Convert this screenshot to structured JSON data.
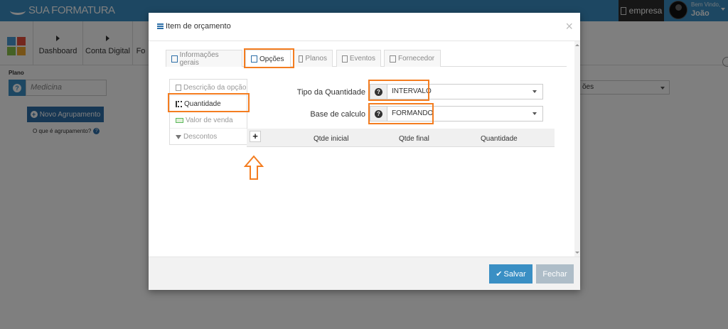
{
  "app": {
    "logo_text": "SUA FORMATURA",
    "empresa_label": "empresa",
    "welcome_text": "Bem Vindo,",
    "user_name": "João"
  },
  "nav": {
    "items": [
      {
        "label": "Dashboard"
      },
      {
        "label": "Conta Digital"
      },
      {
        "label": "Fo"
      }
    ]
  },
  "background": {
    "plan_label": "Plano",
    "plan_value": "Medicina",
    "novo_agrupamento_label": "Novo Agrupamento",
    "help_link_label": "O que é agrupamento?",
    "select_value": "ões"
  },
  "modal": {
    "title": "Item de orçamento",
    "close_label": "×",
    "tabs": [
      {
        "label": "Informações gerais"
      },
      {
        "label": "Opções"
      },
      {
        "label": "Planos"
      },
      {
        "label": "Eventos"
      },
      {
        "label": "Fornecedor"
      }
    ],
    "side_items": [
      {
        "label": "Descrição da opção"
      },
      {
        "label": "Quantidade"
      },
      {
        "label": "Valor de venda"
      },
      {
        "label": "Descontos"
      }
    ],
    "tipo_quantidade_label": "Tipo da Quantidade",
    "tipo_quantidade_value": "INTERVALO",
    "base_calculo_label": "Base de calculo",
    "base_calculo_value": "FORMANDO",
    "table_headers": [
      "Qtde inicial",
      "Qtde final",
      "Quantidade"
    ],
    "add_label": "+",
    "save_label": "Salvar",
    "close_button_label": "Fechar"
  },
  "colors": {
    "accent": "#3a8fc4",
    "highlight": "#f47d20",
    "topbar": "#3a8fc4"
  }
}
